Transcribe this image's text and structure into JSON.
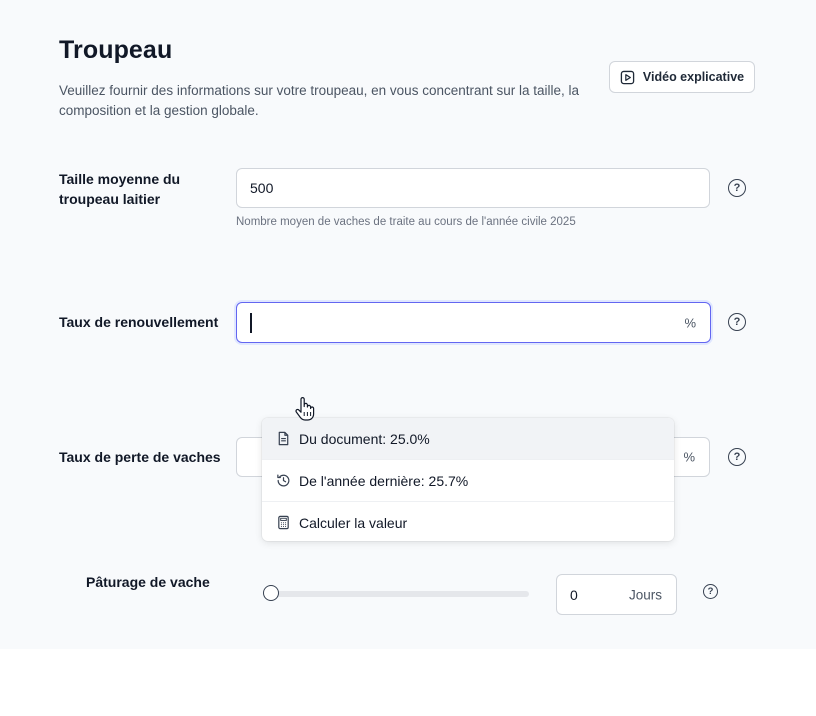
{
  "header": {
    "title": "Troupeau",
    "description": "Veuillez fournir des informations sur votre troupeau, en vous concentrant sur la taille, la composition et la gestion globale.",
    "video_button_label": "Vidéo explicative",
    "video_icon": "play-square-icon"
  },
  "fields": {
    "herd_size": {
      "label": "Taille moyenne du troupeau laitier",
      "value": "500",
      "hint": "Nombre moyen de vaches de traite au cours de l'année civile 2025",
      "help": "?"
    },
    "replacement_rate": {
      "label": "Taux de renouvellement",
      "value": "",
      "unit": "%",
      "help": "?"
    },
    "cow_loss_rate": {
      "label": "Taux de perte de vaches",
      "value": "",
      "unit": "%",
      "help": "?"
    },
    "grazing": {
      "label": "Pâturage de vache",
      "value": "0",
      "unit": "Jours",
      "slider_level": 0,
      "help": "?"
    }
  },
  "suggestions": [
    {
      "icon": "document-icon",
      "label": "Du document: 25.0%"
    },
    {
      "icon": "history-icon",
      "label": "De l'année dernière: 25.7%"
    },
    {
      "icon": "calculator-icon",
      "label": "Calculer la valeur"
    }
  ],
  "colors": {
    "focus_border": "#6366f1",
    "panel_background": "#f8fafc",
    "text_primary": "#111827"
  }
}
